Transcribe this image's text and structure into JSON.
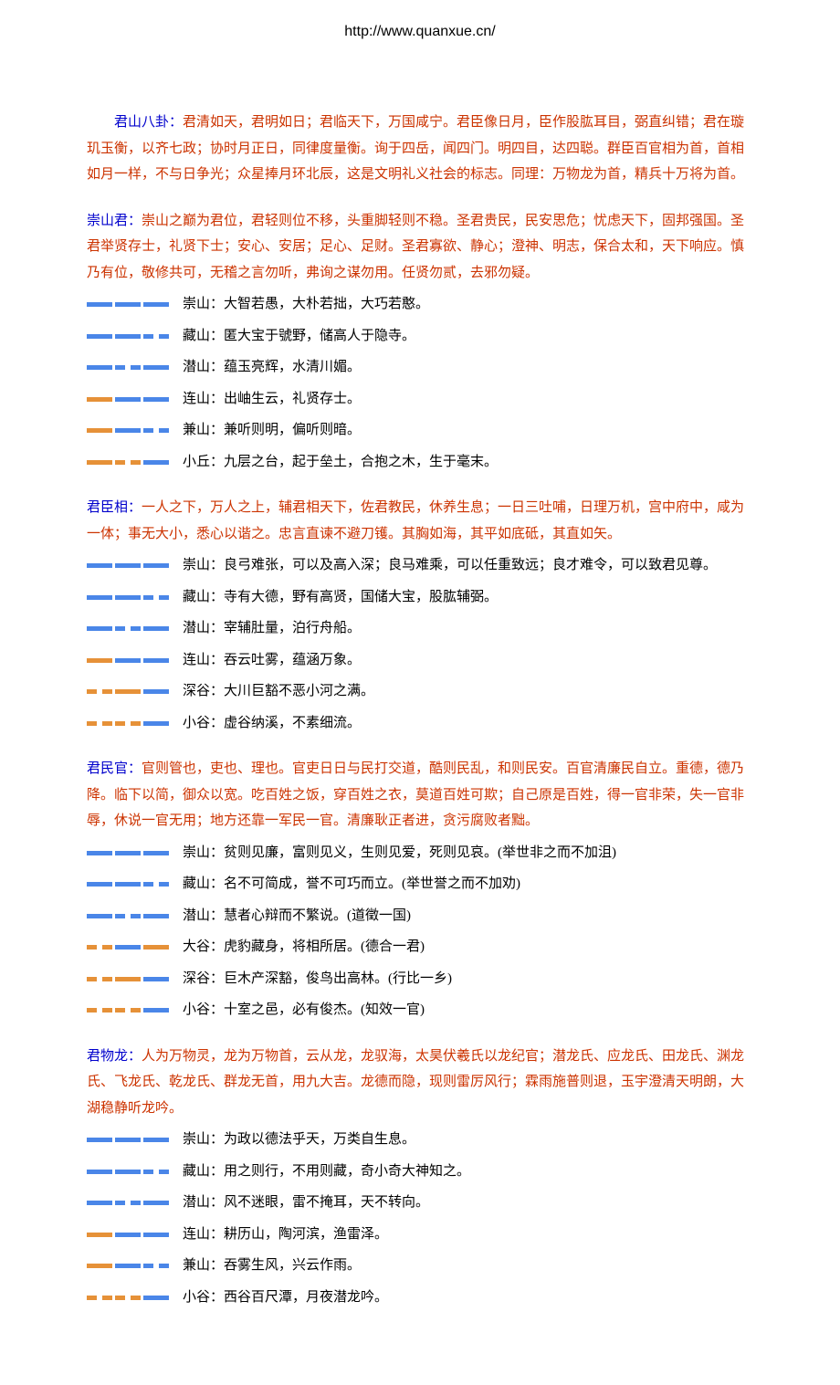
{
  "header_url": "http://www.quanxue.cn/",
  "sections": [
    {
      "title": "君山八卦：",
      "intro_class": "intro",
      "body": "君清如天，君明如日；君临天下，万国咸宁。君臣像日月，臣作股肱耳目，弼直纠错；君在璇玑玉衡，以齐七政；协时月正日，同律度量衡。询于四岳，闻四门。明四目，达四聪。群臣百官相为首，首相如月一样，不与日争光；众星捧月环北辰，这是文明礼义社会的标志。同理：万物龙为首，精兵十万将为首。",
      "items": []
    },
    {
      "title": "崇山君：",
      "intro_class": "",
      "body": "崇山之巅为君位，君轻则位不移，头重脚轻则不稳。圣君贵民，民安思危；忧虑天下，固邦强国。圣君举贤存士，礼贤下士；安心、安居；足心、足财。圣君寡欲、静心；澄神、明志，保合太和，天下响应。慎乃有位，敬修共可，无稽之言勿听，弗询之谋勿用。任贤勿贰，去邪勿疑。",
      "items": [
        {
          "hex": [
            [
              "blue",
              "solid"
            ],
            [
              "blue",
              "solid"
            ],
            [
              "blue",
              "solid"
            ]
          ],
          "text": "崇山：大智若愚，大朴若拙，大巧若憨。"
        },
        {
          "hex": [
            [
              "blue",
              "solid"
            ],
            [
              "blue",
              "solid"
            ],
            [
              "blue",
              "broken"
            ]
          ],
          "text": "藏山：匿大宝于號野，储高人于隐寺。"
        },
        {
          "hex": [
            [
              "blue",
              "solid"
            ],
            [
              "blue",
              "broken"
            ],
            [
              "blue",
              "solid"
            ]
          ],
          "text": "潜山：蕴玉亮辉，水清川媚。"
        },
        {
          "hex": [
            [
              "orange",
              "solid"
            ],
            [
              "blue",
              "solid"
            ],
            [
              "blue",
              "solid"
            ]
          ],
          "text": "连山：出岫生云，礼贤存士。"
        },
        {
          "hex": [
            [
              "orange",
              "solid"
            ],
            [
              "blue",
              "solid"
            ],
            [
              "blue",
              "broken"
            ]
          ],
          "text": "兼山：兼听则明，偏听则暗。"
        },
        {
          "hex": [
            [
              "orange",
              "solid"
            ],
            [
              "orange",
              "broken"
            ],
            [
              "blue",
              "solid"
            ]
          ],
          "text": "小丘：九层之台，起于垒土，合抱之木，生于毫末。"
        }
      ]
    },
    {
      "title": "君臣相：",
      "intro_class": "",
      "body": "一人之下，万人之上，辅君相天下，佐君教民，休养生息；一日三吐哺，日理万机，宫中府中，咸为一体；事无大小，悉心以谐之。忠言直谏不避刀镬。其胸如海，其平如底砥，其直如矢。",
      "items": [
        {
          "hex": [
            [
              "blue",
              "solid"
            ],
            [
              "blue",
              "solid"
            ],
            [
              "blue",
              "solid"
            ]
          ],
          "text": "崇山：良弓难张，可以及高入深；良马难乘，可以任重致远；良才难令，可以致君见尊。"
        },
        {
          "hex": [
            [
              "blue",
              "solid"
            ],
            [
              "blue",
              "solid"
            ],
            [
              "blue",
              "broken"
            ]
          ],
          "text": "藏山：寺有大德，野有高贤，国储大宝，股肱辅弼。"
        },
        {
          "hex": [
            [
              "blue",
              "solid"
            ],
            [
              "blue",
              "broken"
            ],
            [
              "blue",
              "solid"
            ]
          ],
          "text": "潜山：宰辅肚量，泊行舟船。"
        },
        {
          "hex": [
            [
              "orange",
              "solid"
            ],
            [
              "blue",
              "solid"
            ],
            [
              "blue",
              "solid"
            ]
          ],
          "text": "连山：吞云吐雾，蕴涵万象。"
        },
        {
          "hex": [
            [
              "orange",
              "broken"
            ],
            [
              "orange",
              "solid"
            ],
            [
              "blue",
              "solid"
            ]
          ],
          "text": "深谷：大川巨豁不恶小河之满。"
        },
        {
          "hex": [
            [
              "orange",
              "broken"
            ],
            [
              "orange",
              "broken"
            ],
            [
              "blue",
              "solid"
            ]
          ],
          "text": "小谷：虚谷纳溪，不素细流。"
        }
      ]
    },
    {
      "title": "君民官：",
      "intro_class": "",
      "body": "官则管也，吏也、理也。官吏日日与民打交道，酷则民乱，和则民安。百官清廉民自立。重德，德乃降。临下以简，御众以宽。吃百姓之饭，穿百姓之衣，莫道百姓可欺；自己原是百姓，得一官非荣，失一官非辱，休说一官无用；地方还靠一军民一官。清廉耿正者进，贪污腐败者黜。",
      "items": [
        {
          "hex": [
            [
              "blue",
              "solid"
            ],
            [
              "blue",
              "solid"
            ],
            [
              "blue",
              "solid"
            ]
          ],
          "text": "崇山：贫则见廉，富则见义，生则见爱，死则见哀。(举世非之而不加沮)"
        },
        {
          "hex": [
            [
              "blue",
              "solid"
            ],
            [
              "blue",
              "solid"
            ],
            [
              "blue",
              "broken"
            ]
          ],
          "text": "藏山：名不可简成，誉不可巧而立。(举世誉之而不加劝)"
        },
        {
          "hex": [
            [
              "blue",
              "solid"
            ],
            [
              "blue",
              "broken"
            ],
            [
              "blue",
              "solid"
            ]
          ],
          "text": "潜山：慧者心辩而不繁说。(道徵一国)"
        },
        {
          "hex": [
            [
              "orange",
              "broken"
            ],
            [
              "blue",
              "solid"
            ],
            [
              "orange",
              "solid"
            ]
          ],
          "text": "大谷：虎豹藏身，将相所居。(德合一君)"
        },
        {
          "hex": [
            [
              "orange",
              "broken"
            ],
            [
              "orange",
              "solid"
            ],
            [
              "blue",
              "solid"
            ]
          ],
          "text": "深谷：巨木产深豁，俊鸟出高林。(行比一乡)"
        },
        {
          "hex": [
            [
              "orange",
              "broken"
            ],
            [
              "orange",
              "broken"
            ],
            [
              "blue",
              "solid"
            ]
          ],
          "text": "小谷：十室之邑，必有俊杰。(知效一官)"
        }
      ]
    },
    {
      "title": "君物龙：",
      "intro_class": "",
      "body": "人为万物灵，龙为万物首，云从龙，龙驭海，太昊伏羲氏以龙纪官；潜龙氏、应龙氏、田龙氏、渊龙氏、飞龙氏、乾龙氏、群龙无首，用九大吉。龙德而隐，现则雷厉风行；霖雨施普则退，玉宇澄清天明朗，大湖稳静听龙吟。",
      "items": [
        {
          "hex": [
            [
              "blue",
              "solid"
            ],
            [
              "blue",
              "solid"
            ],
            [
              "blue",
              "solid"
            ]
          ],
          "text": "崇山：为政以德法乎天，万类自生息。"
        },
        {
          "hex": [
            [
              "blue",
              "solid"
            ],
            [
              "blue",
              "solid"
            ],
            [
              "blue",
              "broken"
            ]
          ],
          "text": "藏山：用之则行，不用则藏，奇小奇大神知之。"
        },
        {
          "hex": [
            [
              "blue",
              "solid"
            ],
            [
              "blue",
              "broken"
            ],
            [
              "blue",
              "solid"
            ]
          ],
          "text": "潜山：风不迷眼，雷不掩耳，天不转向。"
        },
        {
          "hex": [
            [
              "orange",
              "solid"
            ],
            [
              "blue",
              "solid"
            ],
            [
              "blue",
              "solid"
            ]
          ],
          "text": "连山：耕历山，陶河滨，渔雷泽。"
        },
        {
          "hex": [
            [
              "orange",
              "solid"
            ],
            [
              "blue",
              "solid"
            ],
            [
              "blue",
              "broken"
            ]
          ],
          "text": "兼山：吞雾生风，兴云作雨。"
        },
        {
          "hex": [
            [
              "orange",
              "broken"
            ],
            [
              "orange",
              "broken"
            ],
            [
              "blue",
              "solid"
            ]
          ],
          "text": "小谷：西谷百尺潭，月夜潜龙吟。"
        }
      ]
    }
  ]
}
